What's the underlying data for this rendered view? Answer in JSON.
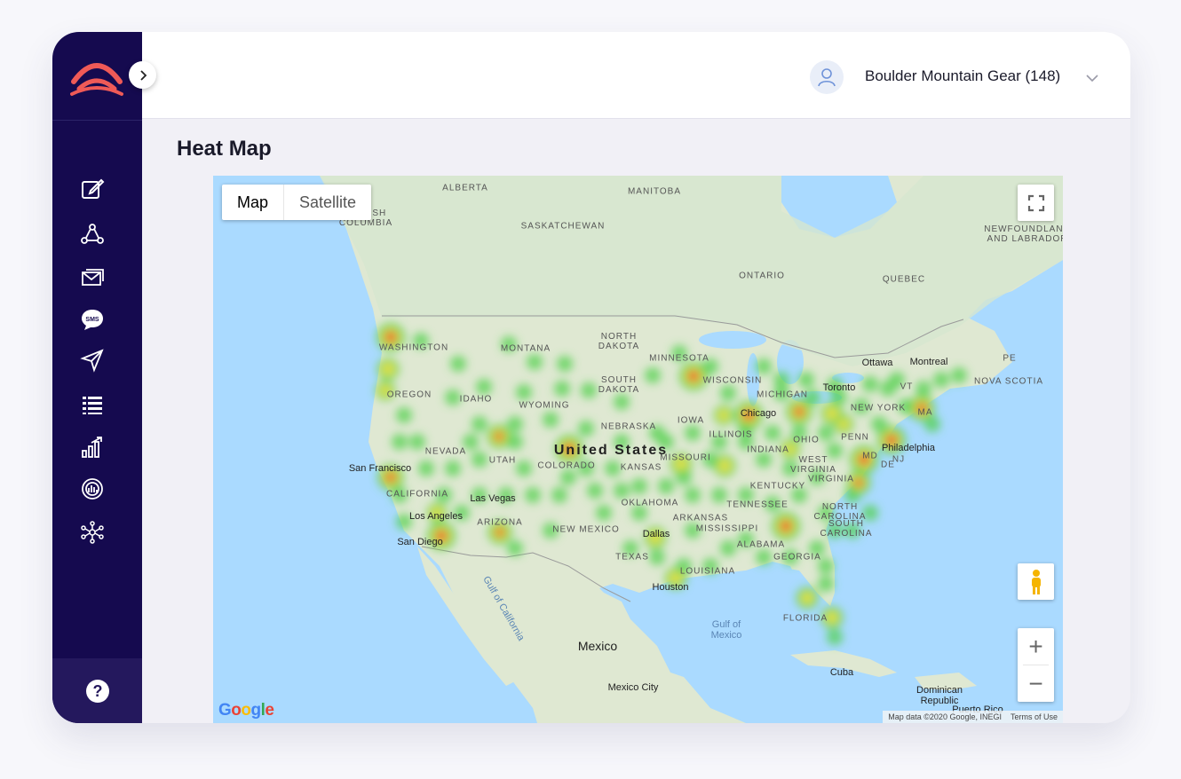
{
  "header": {
    "account_name": "Boulder Mountain Gear (148)"
  },
  "page": {
    "title": "Heat Map"
  },
  "icons": {
    "logo": "brand-logo-icon",
    "toggle": "chevron-right-icon",
    "nav": [
      "edit-icon",
      "network-icon",
      "email-icon",
      "sms-icon",
      "send-icon",
      "list-icon",
      "bar-chart-icon",
      "gauge-icon",
      "hub-icon"
    ],
    "help": "help-icon",
    "user": "user-icon",
    "caret": "chevron-down-icon"
  },
  "colors": {
    "sidebar": "#150a4f",
    "logo_accent": "#ef5a57",
    "heat_high": "#e8332b",
    "heat_mid": "#f1e34a",
    "heat_low": "#4fd04a"
  },
  "map": {
    "type_buttons": [
      "Map",
      "Satellite"
    ],
    "active_type": "Map",
    "zoom_in": "+",
    "zoom_out": "−",
    "google": "Google",
    "attribution": "Map data ©2020 Google, INEGI",
    "terms": "Terms of Use",
    "labels": {
      "regions": [
        "ALBERTA",
        "MANITOBA",
        "SASKATCHEWAN",
        "BRITISH COLUMBIA",
        "ONTARIO",
        "QUEBEC",
        "NEWFOUNDLAND AND LABRADOR",
        "PE",
        "NOVA SCOTIA",
        "WASHINGTON",
        "MONTANA",
        "NORTH DAKOTA",
        "MINNESOTA",
        "OREGON",
        "IDAHO",
        "SOUTH DAKOTA",
        "WISCONSIN",
        "MICHIGAN",
        "WYOMING",
        "NEBRASKA",
        "IOWA",
        "NEW YORK",
        "NEVADA",
        "UTAH",
        "COLORADO",
        "KANSAS",
        "ILLINOIS",
        "OHIO",
        "PENN",
        "CALIFORNIA",
        "ARIZONA",
        "NEW MEXICO",
        "OKLAHOMA",
        "ARKANSAS",
        "TENNESSEE",
        "KENTUCKY",
        "WEST VIRGINIA",
        "VIRGINIA",
        "NORTH CAROLINA",
        "SOUTH CAROLINA",
        "MISSISSIPPI",
        "ALABAMA",
        "GEORGIA",
        "TEXAS",
        "LOUISIANA",
        "FLORIDA",
        "INDIANA",
        "MISSOURI",
        "MD",
        "DE",
        "NJ",
        "MA",
        "VT"
      ],
      "countries": [
        "United States",
        "Mexico"
      ],
      "cities": [
        "Ottawa",
        "Montreal",
        "Toronto",
        "Chicago",
        "Philadelphia",
        "San Francisco",
        "Las Vegas",
        "Los Angeles",
        "San Diego",
        "Dallas",
        "Houston",
        "Mexico City",
        "Cuba",
        "Dominican Republic",
        "Puerto Rico"
      ],
      "water": [
        "Gulf of Mexico",
        "Gulf of California"
      ]
    }
  }
}
